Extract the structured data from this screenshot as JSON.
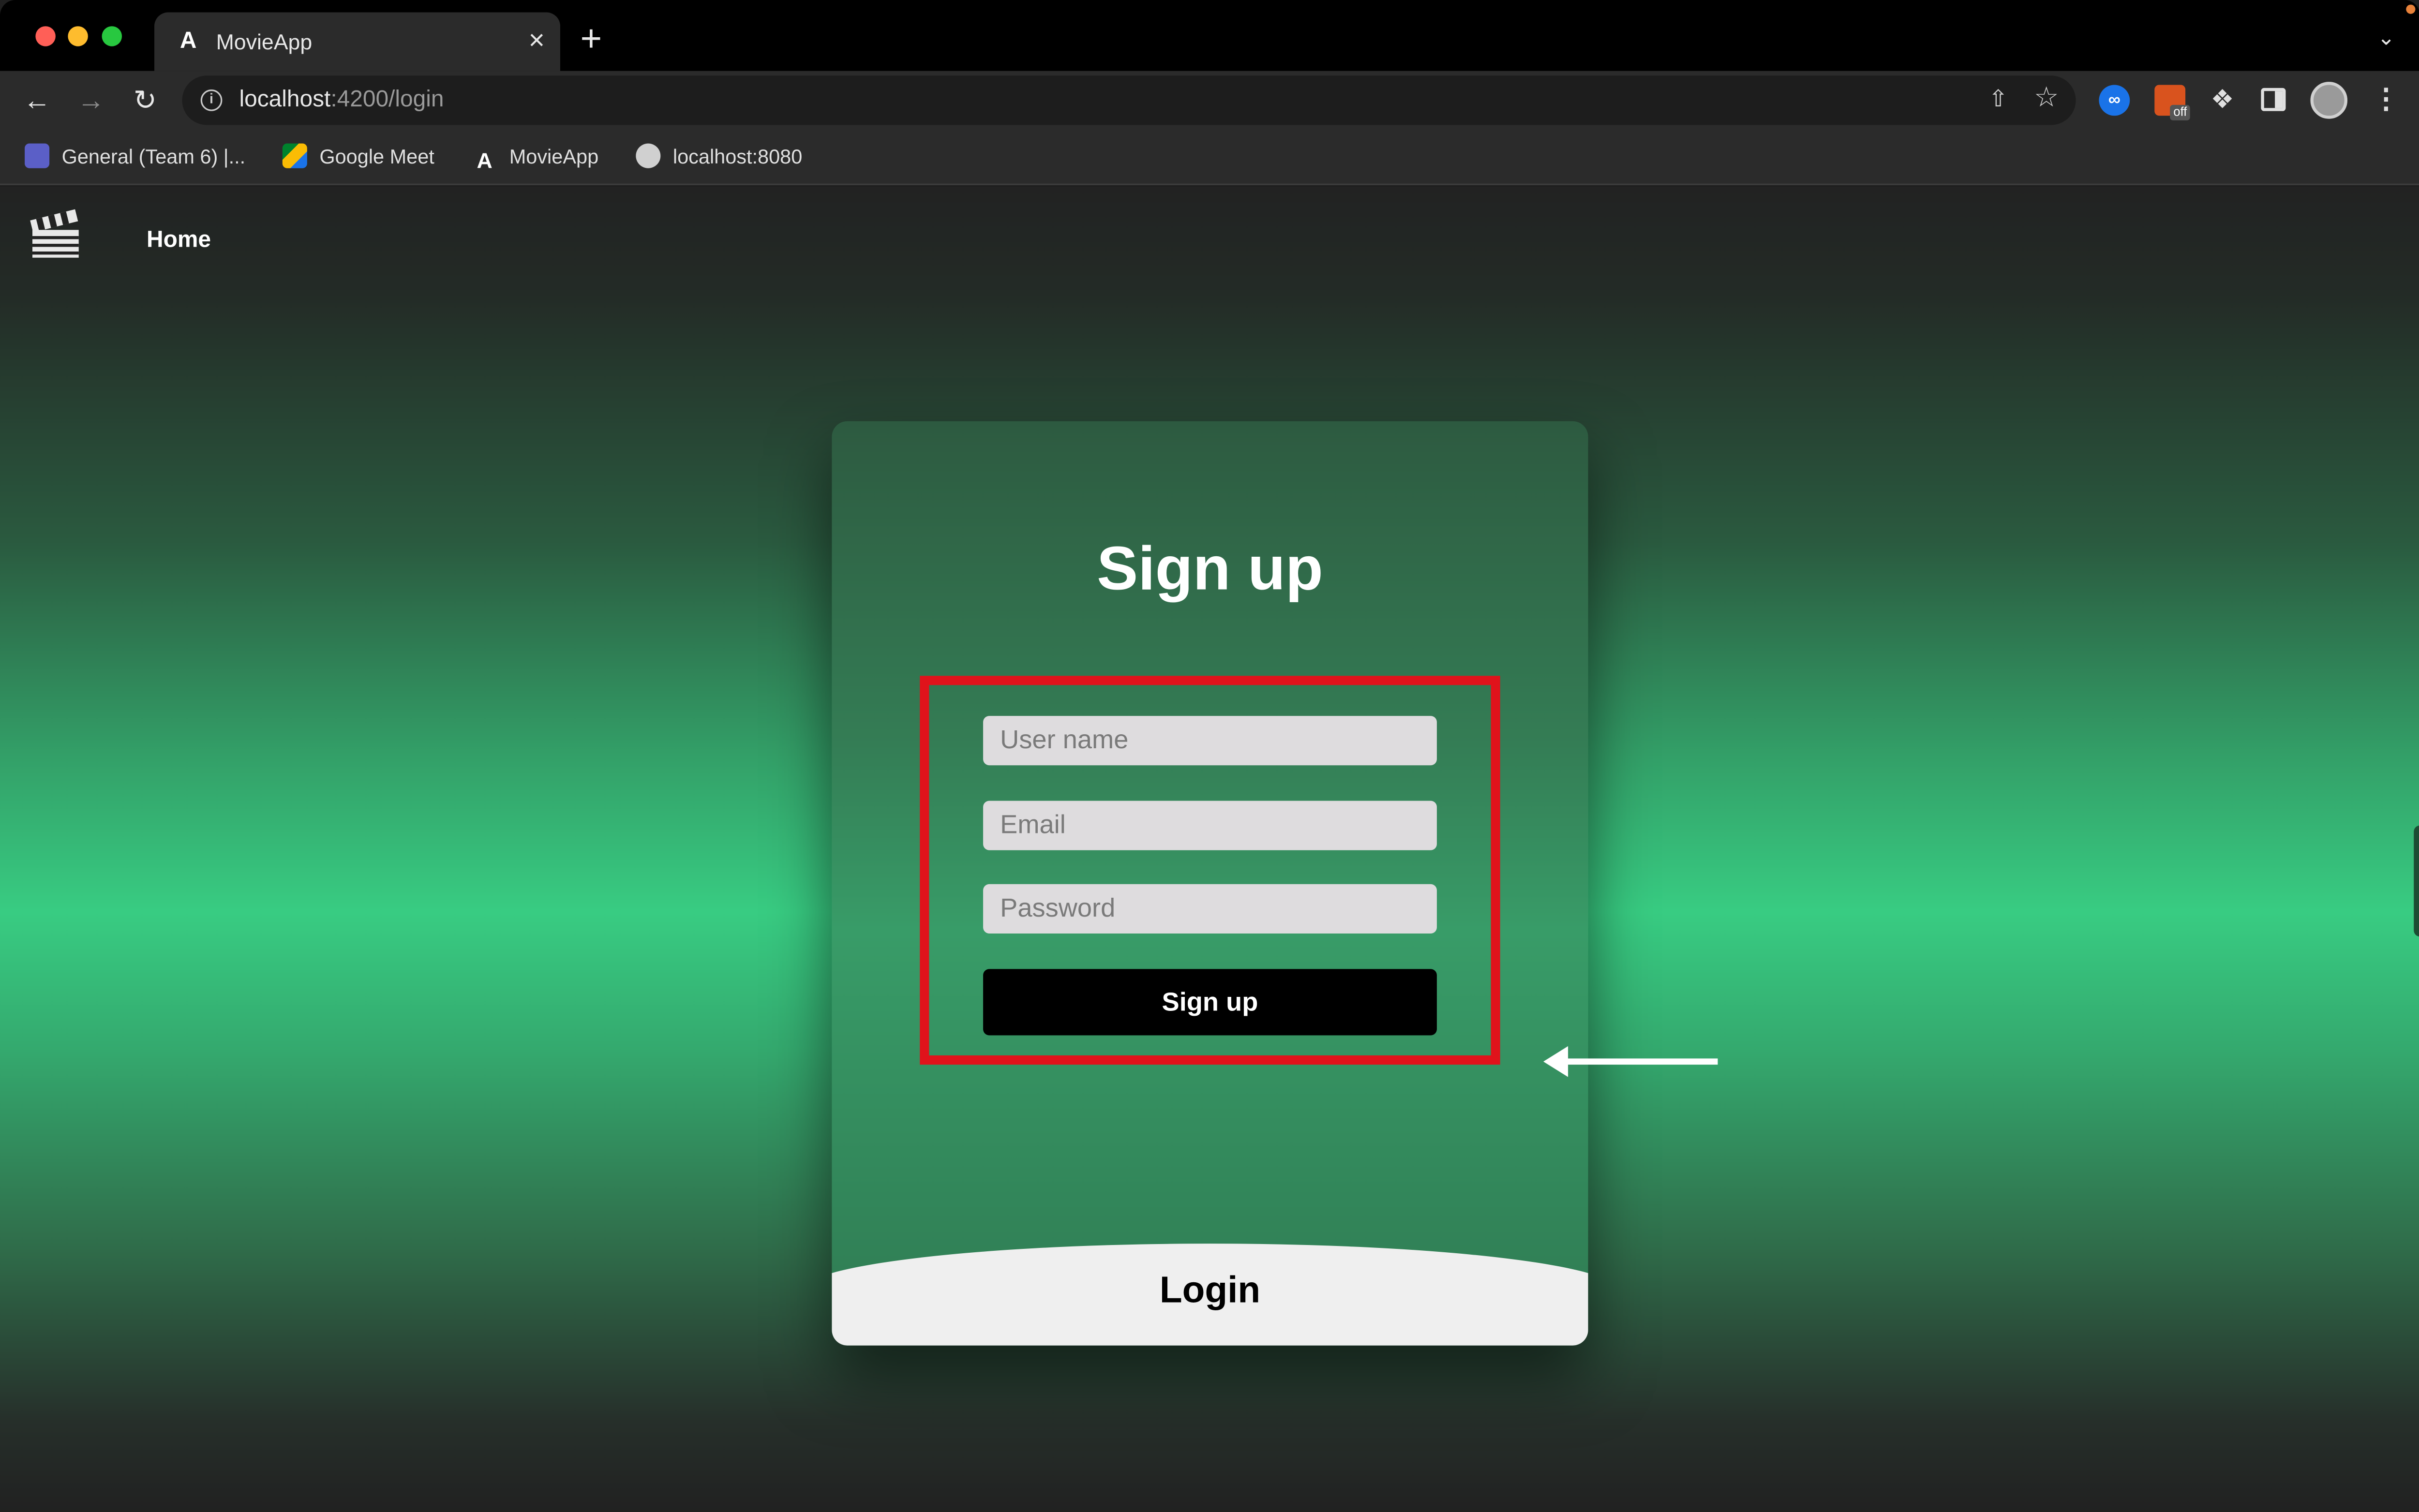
{
  "browser": {
    "tab_title": "MovieApp",
    "tab_favicon": "A",
    "tab_close": "×",
    "new_tab": "+",
    "url_host": "localhost",
    "url_path": ":4200/login",
    "bookmarks": [
      {
        "label": "General (Team 6) |...",
        "icon": "teams-icon"
      },
      {
        "label": "Google Meet",
        "icon": "google-meet-icon"
      },
      {
        "label": "MovieApp",
        "icon": "angular-icon"
      },
      {
        "label": "localhost:8080",
        "icon": "globe-icon"
      }
    ],
    "extension_badge": "off"
  },
  "app": {
    "nav": {
      "home_label": "Home"
    },
    "form": {
      "title": "Sign up",
      "username_placeholder": "User name",
      "email_placeholder": "Email",
      "password_placeholder": "Password",
      "submit_label": "Sign up",
      "login_label": "Login"
    }
  },
  "colors": {
    "highlight_border": "#e0131b",
    "accent_green": "#38cc82",
    "button_black": "#000000"
  }
}
